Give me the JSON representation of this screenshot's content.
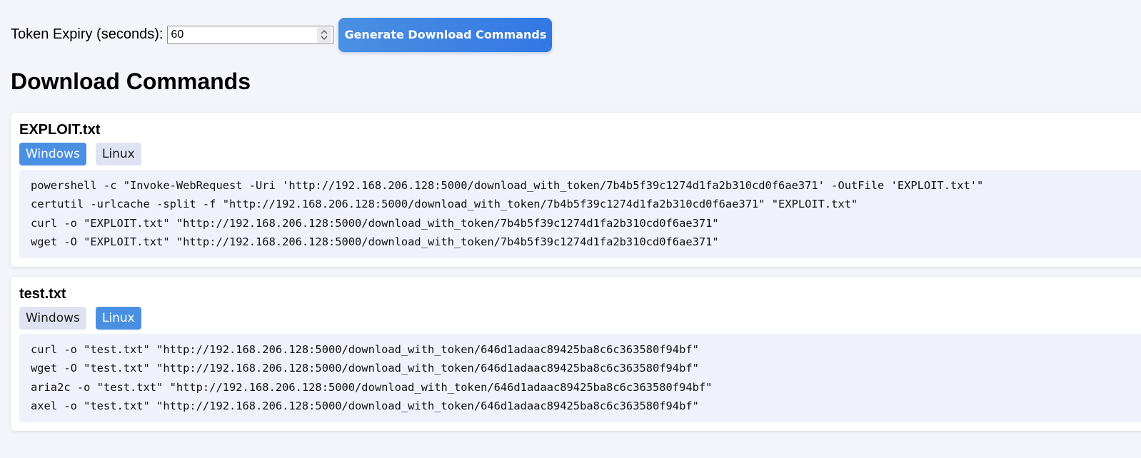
{
  "toolbar": {
    "expiry_label": "Token Expiry (seconds):",
    "expiry_value": "60",
    "generate_label": "Generate Download Commands"
  },
  "section": {
    "title": "Download Commands"
  },
  "files": [
    {
      "name": "EXPLOIT.txt",
      "tabs": [
        {
          "label": "Windows",
          "active": true
        },
        {
          "label": "Linux",
          "active": false
        }
      ],
      "commands": [
        "powershell -c \"Invoke-WebRequest -Uri 'http://192.168.206.128:5000/download_with_token/7b4b5f39c1274d1fa2b310cd0f6ae371' -OutFile 'EXPLOIT.txt'\"",
        "certutil -urlcache -split -f \"http://192.168.206.128:5000/download_with_token/7b4b5f39c1274d1fa2b310cd0f6ae371\" \"EXPLOIT.txt\"",
        "curl -o \"EXPLOIT.txt\" \"http://192.168.206.128:5000/download_with_token/7b4b5f39c1274d1fa2b310cd0f6ae371\"",
        "wget -O \"EXPLOIT.txt\" \"http://192.168.206.128:5000/download_with_token/7b4b5f39c1274d1fa2b310cd0f6ae371\""
      ]
    },
    {
      "name": "test.txt",
      "tabs": [
        {
          "label": "Windows",
          "active": false
        },
        {
          "label": "Linux",
          "active": true
        }
      ],
      "commands": [
        "curl -o \"test.txt\" \"http://192.168.206.128:5000/download_with_token/646d1adaac89425ba8c6c363580f94bf\"",
        "wget -O \"test.txt\" \"http://192.168.206.128:5000/download_with_token/646d1adaac89425ba8c6c363580f94bf\"",
        "aria2c -o \"test.txt\" \"http://192.168.206.128:5000/download_with_token/646d1adaac89425ba8c6c363580f94bf\"",
        "axel -o \"test.txt\" \"http://192.168.206.128:5000/download_with_token/646d1adaac89425ba8c6c363580f94bf\""
      ]
    }
  ],
  "colors": {
    "accent": "#4a90e2",
    "tab_inactive": "#dfe3f1",
    "code_background": "#eff2fa",
    "page_background": "#f4f5fa"
  },
  "icons": {
    "spinner_up": "chevron-up-icon",
    "spinner_down": "chevron-down-icon"
  }
}
